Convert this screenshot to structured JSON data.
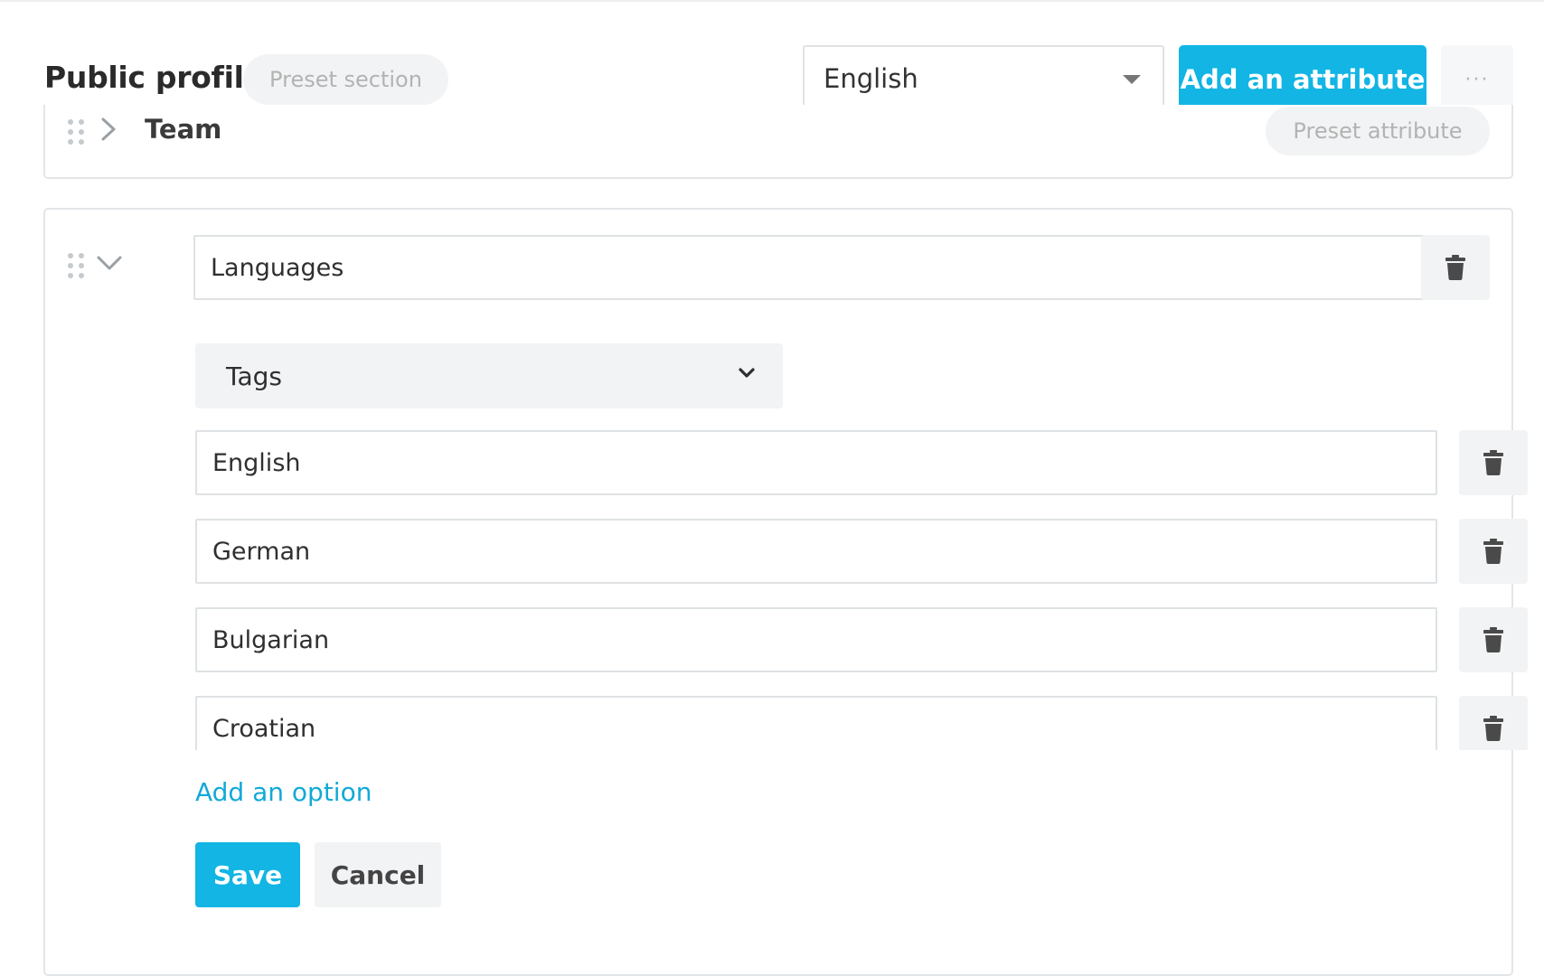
{
  "header": {
    "title": "Public profile",
    "section_badge": "Preset section",
    "language_select": {
      "selected": "English"
    },
    "add_attribute_label": "Add an attribute",
    "more_label": "···"
  },
  "sections": {
    "team": {
      "label": "Team",
      "badge": "Preset attribute"
    },
    "languages": {
      "name_value": "Languages",
      "type_select": {
        "selected": "Tags"
      },
      "options": [
        {
          "value": "English"
        },
        {
          "value": "German"
        },
        {
          "value": "Bulgarian"
        },
        {
          "value": "Croatian"
        }
      ],
      "add_option_label": "Add an option",
      "save_label": "Save",
      "cancel_label": "Cancel"
    }
  },
  "colors": {
    "accent": "#12b5e3",
    "link": "#12a9d8",
    "muted_bg": "#f2f3f4",
    "border": "#e3e6e8",
    "icon": "#4a4a4a"
  },
  "icons": {
    "drag": "drag-handle-icon",
    "expand": "chevron-right-icon",
    "collapse": "chevron-down-icon",
    "delete": "trash-icon",
    "dropdown": "caret-down-icon"
  }
}
